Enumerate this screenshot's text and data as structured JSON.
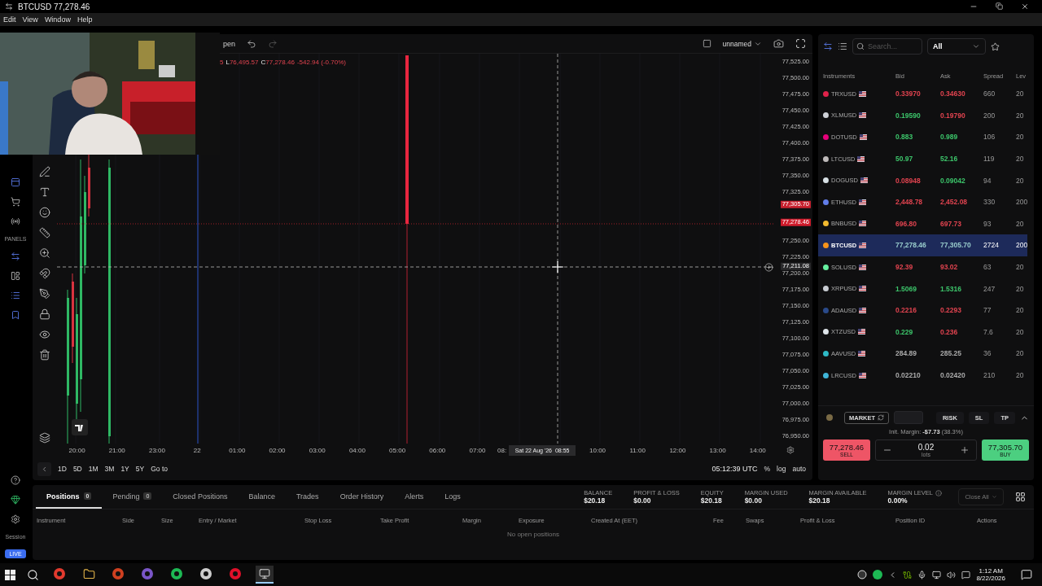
{
  "window": {
    "title": "BTCUSD 77,278.46",
    "menu": [
      "Edit",
      "View",
      "Window",
      "Help"
    ]
  },
  "sidebar": {
    "section_label": "PANELS",
    "session_label": "Session",
    "live_badge": "LIVE"
  },
  "chart": {
    "toolbar": {
      "partial_label": "pen",
      "layout_name": "unnamed"
    },
    "legend": {
      "fragment": "5",
      "low_label": "L",
      "low": "76,495.57",
      "close_label": "C",
      "close": "77,278.46",
      "change": "-542.94 (-0.70%)"
    },
    "price_axis": [
      "77,525.00",
      "77,500.00",
      "77,475.00",
      "77,450.00",
      "77,425.00",
      "77,400.00",
      "77,375.00",
      "77,350.00",
      "77,325.00",
      "77,250.00",
      "77,225.00",
      "77,200.00",
      "77,175.00",
      "77,150.00",
      "77,125.00",
      "77,100.00",
      "77,075.00",
      "77,050.00",
      "77,025.00",
      "77,000.00",
      "76,975.00",
      "76,950.00"
    ],
    "price_markers": [
      {
        "price": "77,305.70",
        "kind": "ask"
      },
      {
        "price": "77,278.46",
        "kind": "bid"
      },
      {
        "price": "77,211.08",
        "kind": "crosshair"
      }
    ],
    "time_axis": [
      "20:00",
      "21:00",
      "23:00",
      "22",
      "01:00",
      "02:00",
      "03:00",
      "04:00",
      "05:00",
      "06:00",
      "07:00",
      "08:",
      "10:00",
      "11:00",
      "12:00",
      "13:00",
      "14:00"
    ],
    "time_cursor": "Sat 22 Aug '26  08:55",
    "ranges": [
      "1D",
      "5D",
      "1M",
      "3M",
      "1Y",
      "5Y",
      "Go to"
    ],
    "clock": "05:12:39 UTC",
    "scale_options": [
      "%",
      "log",
      "auto"
    ]
  },
  "instruments": {
    "search_placeholder": "Search...",
    "filter": "All",
    "columns": [
      "Instruments",
      "Bid",
      "Ask",
      "Spread",
      "Lev"
    ],
    "rows": [
      {
        "symbol": "TRXUSD",
        "color": "#e0224a",
        "bid": {
          "value": "0.33970",
          "color": "#e0434f"
        },
        "ask": {
          "value": "0.34630",
          "color": "#e0434f"
        },
        "spread": "660",
        "leverage": "20",
        "selected": false
      },
      {
        "symbol": "XLMUSD",
        "color": "#cfd2d8",
        "bid": {
          "value": "0.19590",
          "color": "#3cc46a"
        },
        "ask": {
          "value": "0.19790",
          "color": "#e0434f"
        },
        "spread": "200",
        "leverage": "20",
        "selected": false
      },
      {
        "symbol": "DOTUSD",
        "color": "#e6007a",
        "bid": {
          "value": "0.883",
          "color": "#3cc46a"
        },
        "ask": {
          "value": "0.989",
          "color": "#3cc46a"
        },
        "spread": "106",
        "leverage": "20",
        "selected": false
      },
      {
        "symbol": "LTCUSD",
        "color": "#bfbbbb",
        "bid": {
          "value": "50.97",
          "color": "#3cc46a"
        },
        "ask": {
          "value": "52.16",
          "color": "#3cc46a"
        },
        "spread": "119",
        "leverage": "20",
        "selected": false
      },
      {
        "symbol": "DOGUSD",
        "color": "#d8e1e6",
        "bid": {
          "value": "0.08948",
          "color": "#e0434f"
        },
        "ask": {
          "value": "0.09042",
          "color": "#3cc46a"
        },
        "spread": "94",
        "leverage": "20",
        "selected": false
      },
      {
        "symbol": "ETHUSD",
        "color": "#627eea",
        "bid": {
          "value": "2,448.78",
          "color": "#e0434f"
        },
        "ask": {
          "value": "2,452.08",
          "color": "#e0434f"
        },
        "spread": "330",
        "leverage": "200",
        "selected": false
      },
      {
        "symbol": "BNBUSD",
        "color": "#f3ba2f",
        "bid": {
          "value": "696.80",
          "color": "#e0434f"
        },
        "ask": {
          "value": "697.73",
          "color": "#e0434f"
        },
        "spread": "93",
        "leverage": "20",
        "selected": false
      },
      {
        "symbol": "BTCUSD",
        "color": "#f7931a",
        "bid": {
          "value": "77,278.46",
          "color": "#99cccc"
        },
        "ask": {
          "value": "77,305.70",
          "color": "#99cccc"
        },
        "spread": "2724",
        "leverage": "200",
        "selected": true
      },
      {
        "symbol": "SOLUSD",
        "color": "#66f0a0",
        "bid": {
          "value": "92.39",
          "color": "#e0434f"
        },
        "ask": {
          "value": "93.02",
          "color": "#e0434f"
        },
        "spread": "63",
        "leverage": "20",
        "selected": false
      },
      {
        "symbol": "XRPUSD",
        "color": "#c8ccd2",
        "bid": {
          "value": "1.5069",
          "color": "#3cc46a"
        },
        "ask": {
          "value": "1.5316",
          "color": "#3cc46a"
        },
        "spread": "247",
        "leverage": "20",
        "selected": false
      },
      {
        "symbol": "ADAUSD",
        "color": "#2a4a8a",
        "bid": {
          "value": "0.2216",
          "color": "#e0434f"
        },
        "ask": {
          "value": "0.2293",
          "color": "#e0434f"
        },
        "spread": "77",
        "leverage": "20",
        "selected": false
      },
      {
        "symbol": "XTZUSD",
        "color": "#dfe5ea",
        "bid": {
          "value": "0.229",
          "color": "#3cc46a"
        },
        "ask": {
          "value": "0.236",
          "color": "#e0434f"
        },
        "spread": "7.6",
        "leverage": "20",
        "selected": false
      },
      {
        "symbol": "AAVUSD",
        "color": "#2ebac6",
        "bid": {
          "value": "284.89",
          "color": "#aaaaaa"
        },
        "ask": {
          "value": "285.25",
          "color": "#aaaaaa"
        },
        "spread": "36",
        "leverage": "20",
        "selected": false
      },
      {
        "symbol": "LRCUSD",
        "color": "#3fb5d8",
        "bid": {
          "value": "0.02210",
          "color": "#aaaaaa"
        },
        "ask": {
          "value": "0.02420",
          "color": "#aaaaaa"
        },
        "spread": "210",
        "leverage": "20",
        "selected": false
      }
    ]
  },
  "order": {
    "type": "MARKET",
    "buttons": [
      "RISK",
      "SL",
      "TP"
    ],
    "margin": "Init. Margin: **-$7.73** (38.3%)",
    "sell": {
      "price": "77,278.46",
      "label": "SELL"
    },
    "lots": {
      "value": "0.02",
      "unit": "lots"
    },
    "buy": {
      "price": "77,305.70",
      "label": "BUY"
    }
  },
  "positions": {
    "tabs": [
      {
        "label": "Positions",
        "count": "0",
        "selected": true
      },
      {
        "label": "Pending",
        "count": "0",
        "selected": false
      },
      {
        "label": "Closed Positions",
        "selected": false
      },
      {
        "label": "Balance",
        "selected": false
      },
      {
        "label": "Trades",
        "selected": false
      },
      {
        "label": "Order History",
        "selected": false
      },
      {
        "label": "Alerts",
        "selected": false
      },
      {
        "label": "Logs",
        "selected": false
      }
    ],
    "stats": [
      {
        "label": "BALANCE",
        "value": "$20.18"
      },
      {
        "label": "PROFIT & LOSS",
        "value": "$0.00"
      },
      {
        "label": "EQUITY",
        "value": "$20.18"
      },
      {
        "label": "MARGIN USED",
        "value": "$0.00"
      },
      {
        "label": "MARGIN AVAILABLE",
        "value": "$20.18"
      },
      {
        "label": "MARGIN LEVEL",
        "value": "0.00%",
        "info_icon": true
      }
    ],
    "close_all": {
      "label": "Close All",
      "disabled": true
    },
    "columns": [
      "Instrument",
      "Side",
      "Size",
      "Entry / Market",
      "Stop Loss",
      "Take Profit",
      "Margin",
      "Exposure",
      "Created At (EET)",
      "Fee",
      "Swaps",
      "Profit & Loss",
      "Position ID",
      "Actions"
    ],
    "empty": "No open positions"
  },
  "taskbar": {
    "time": "1:12 AM",
    "date": "8/22/2026"
  }
}
